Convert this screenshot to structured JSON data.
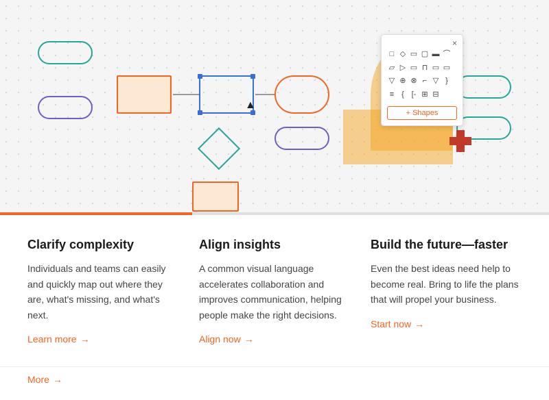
{
  "hero": {
    "alt": "Diagram editor interface showing flowchart shapes"
  },
  "progress": {
    "fill_percent": 35
  },
  "panel": {
    "close_label": "×",
    "add_button_label": "+ Shapes"
  },
  "columns": [
    {
      "id": "clarify",
      "title": "Clarify complexity",
      "body": "Individuals and teams can easily and quickly map out where they are, what's missing, and what's next.",
      "link_text": "Learn more",
      "link_href": "#"
    },
    {
      "id": "align",
      "title": "Align insights",
      "body": "A common visual language accelerates collaboration and improves communication, helping people make the right decisions.",
      "link_text": "Align now",
      "link_href": "#"
    },
    {
      "id": "build",
      "title": "Build the future—faster",
      "body": "Even the best ideas need help to become real. Bring to life the plans that will propel your business.",
      "link_text": "Start now",
      "link_href": "#"
    }
  ],
  "footer": {
    "more_label": "More"
  },
  "colors": {
    "orange": "#f26522",
    "teal": "#26a59a",
    "purple": "#6c5fc7",
    "red": "#c0392b",
    "blob_orange": "#f5a623",
    "gray_text": "#444",
    "panel_border": "#ddd"
  }
}
